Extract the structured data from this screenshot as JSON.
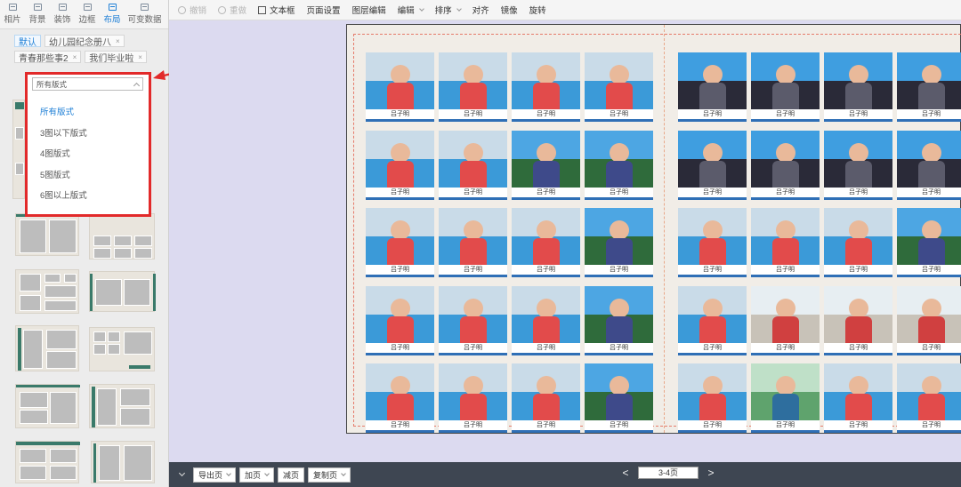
{
  "left_panel": {
    "tabs": [
      {
        "label": "相片",
        "active": false
      },
      {
        "label": "背景",
        "active": false
      },
      {
        "label": "装饰",
        "active": false
      },
      {
        "label": "边框",
        "active": false
      },
      {
        "label": "布局",
        "active": true
      },
      {
        "label": "可变数据",
        "active": false
      }
    ],
    "chips": [
      {
        "label": "默认",
        "closable": false,
        "active": true
      },
      {
        "label": "幼儿园纪念册八",
        "closable": true,
        "active": false
      },
      {
        "label": "青春那些事2",
        "closable": true,
        "active": false
      },
      {
        "label": "我们毕业啦",
        "closable": true,
        "active": false
      }
    ],
    "chip_close_glyph": "×",
    "layout_filter": {
      "selected": "所有版式",
      "options": [
        "所有版式",
        "3图以下版式",
        "4图版式",
        "5图版式",
        "6图以上版式"
      ]
    }
  },
  "toolbar": {
    "undo": "撤销",
    "redo": "重做",
    "text_box": "文本框",
    "page_settings": "页面设置",
    "layer_edit": "图层编辑",
    "edit": "编辑",
    "arrange": "排序",
    "align": "对齐",
    "mirror": "镜像",
    "rotate": "旋转"
  },
  "canvas": {
    "left_page_cards": [
      {
        "caption": "吕子明",
        "theme": "classroom"
      },
      {
        "caption": "吕子明",
        "theme": "classroom"
      },
      {
        "caption": "吕子明",
        "theme": "classroom"
      },
      {
        "caption": "吕子明",
        "theme": "classroom"
      },
      {
        "caption": "吕子明",
        "theme": "classroom"
      },
      {
        "caption": "吕子明",
        "theme": "classroom"
      },
      {
        "caption": "吕子明",
        "theme": "outdoor"
      },
      {
        "caption": "吕子明",
        "theme": "outdoor"
      },
      {
        "caption": "吕子明",
        "theme": "classroom"
      },
      {
        "caption": "吕子明",
        "theme": "classroom"
      },
      {
        "caption": "吕子明",
        "theme": "classroom"
      },
      {
        "caption": "吕子明",
        "theme": "outdoor"
      },
      {
        "caption": "吕子明",
        "theme": "classroom"
      },
      {
        "caption": "吕子明",
        "theme": "classroom"
      },
      {
        "caption": "吕子明",
        "theme": "classroom"
      },
      {
        "caption": "吕子明",
        "theme": "outdoor"
      },
      {
        "caption": "吕子明",
        "theme": "classroom"
      },
      {
        "caption": "吕子明",
        "theme": "classroom"
      },
      {
        "caption": "吕子明",
        "theme": "classroom"
      },
      {
        "caption": "吕子明",
        "theme": "outdoor"
      }
    ],
    "right_page_cards": [
      {
        "caption": "吕子明",
        "theme": "group"
      },
      {
        "caption": "吕子明",
        "theme": "group"
      },
      {
        "caption": "吕子明",
        "theme": "group"
      },
      {
        "caption": "吕子明",
        "theme": "group"
      },
      {
        "caption": "吕子明",
        "theme": "group"
      },
      {
        "caption": "吕子明",
        "theme": "group"
      },
      {
        "caption": "吕子明",
        "theme": "group"
      },
      {
        "caption": "吕子明",
        "theme": "group"
      },
      {
        "caption": "吕子明",
        "theme": "classroom"
      },
      {
        "caption": "吕子明",
        "theme": "classroom"
      },
      {
        "caption": "吕子明",
        "theme": "classroom"
      },
      {
        "caption": "吕子明",
        "theme": "outdoor"
      },
      {
        "caption": "吕子明",
        "theme": "classroom"
      },
      {
        "caption": "吕子明",
        "theme": "window"
      },
      {
        "caption": "吕子明",
        "theme": "window"
      },
      {
        "caption": "吕子明",
        "theme": "window"
      },
      {
        "caption": "吕子明",
        "theme": "classroom"
      },
      {
        "caption": "吕子明",
        "theme": "green"
      },
      {
        "caption": "吕子明",
        "theme": "classroom"
      },
      {
        "caption": "吕子明",
        "theme": "classroom"
      }
    ]
  },
  "bottom_bar": {
    "export_page": "导出页",
    "add_page": "加页",
    "remove_page": "减页",
    "copy_page": "复制页",
    "prev_glyph": "<",
    "next_glyph": ">",
    "page_indicator": "3-4页"
  },
  "colors": {
    "accent": "#1e7fd6",
    "highlight_red": "#e22a2a",
    "layout_green": "#3a7a6a",
    "canvas_bg": "#dcdaf0",
    "bottom_bar_bg": "#3e4652"
  }
}
